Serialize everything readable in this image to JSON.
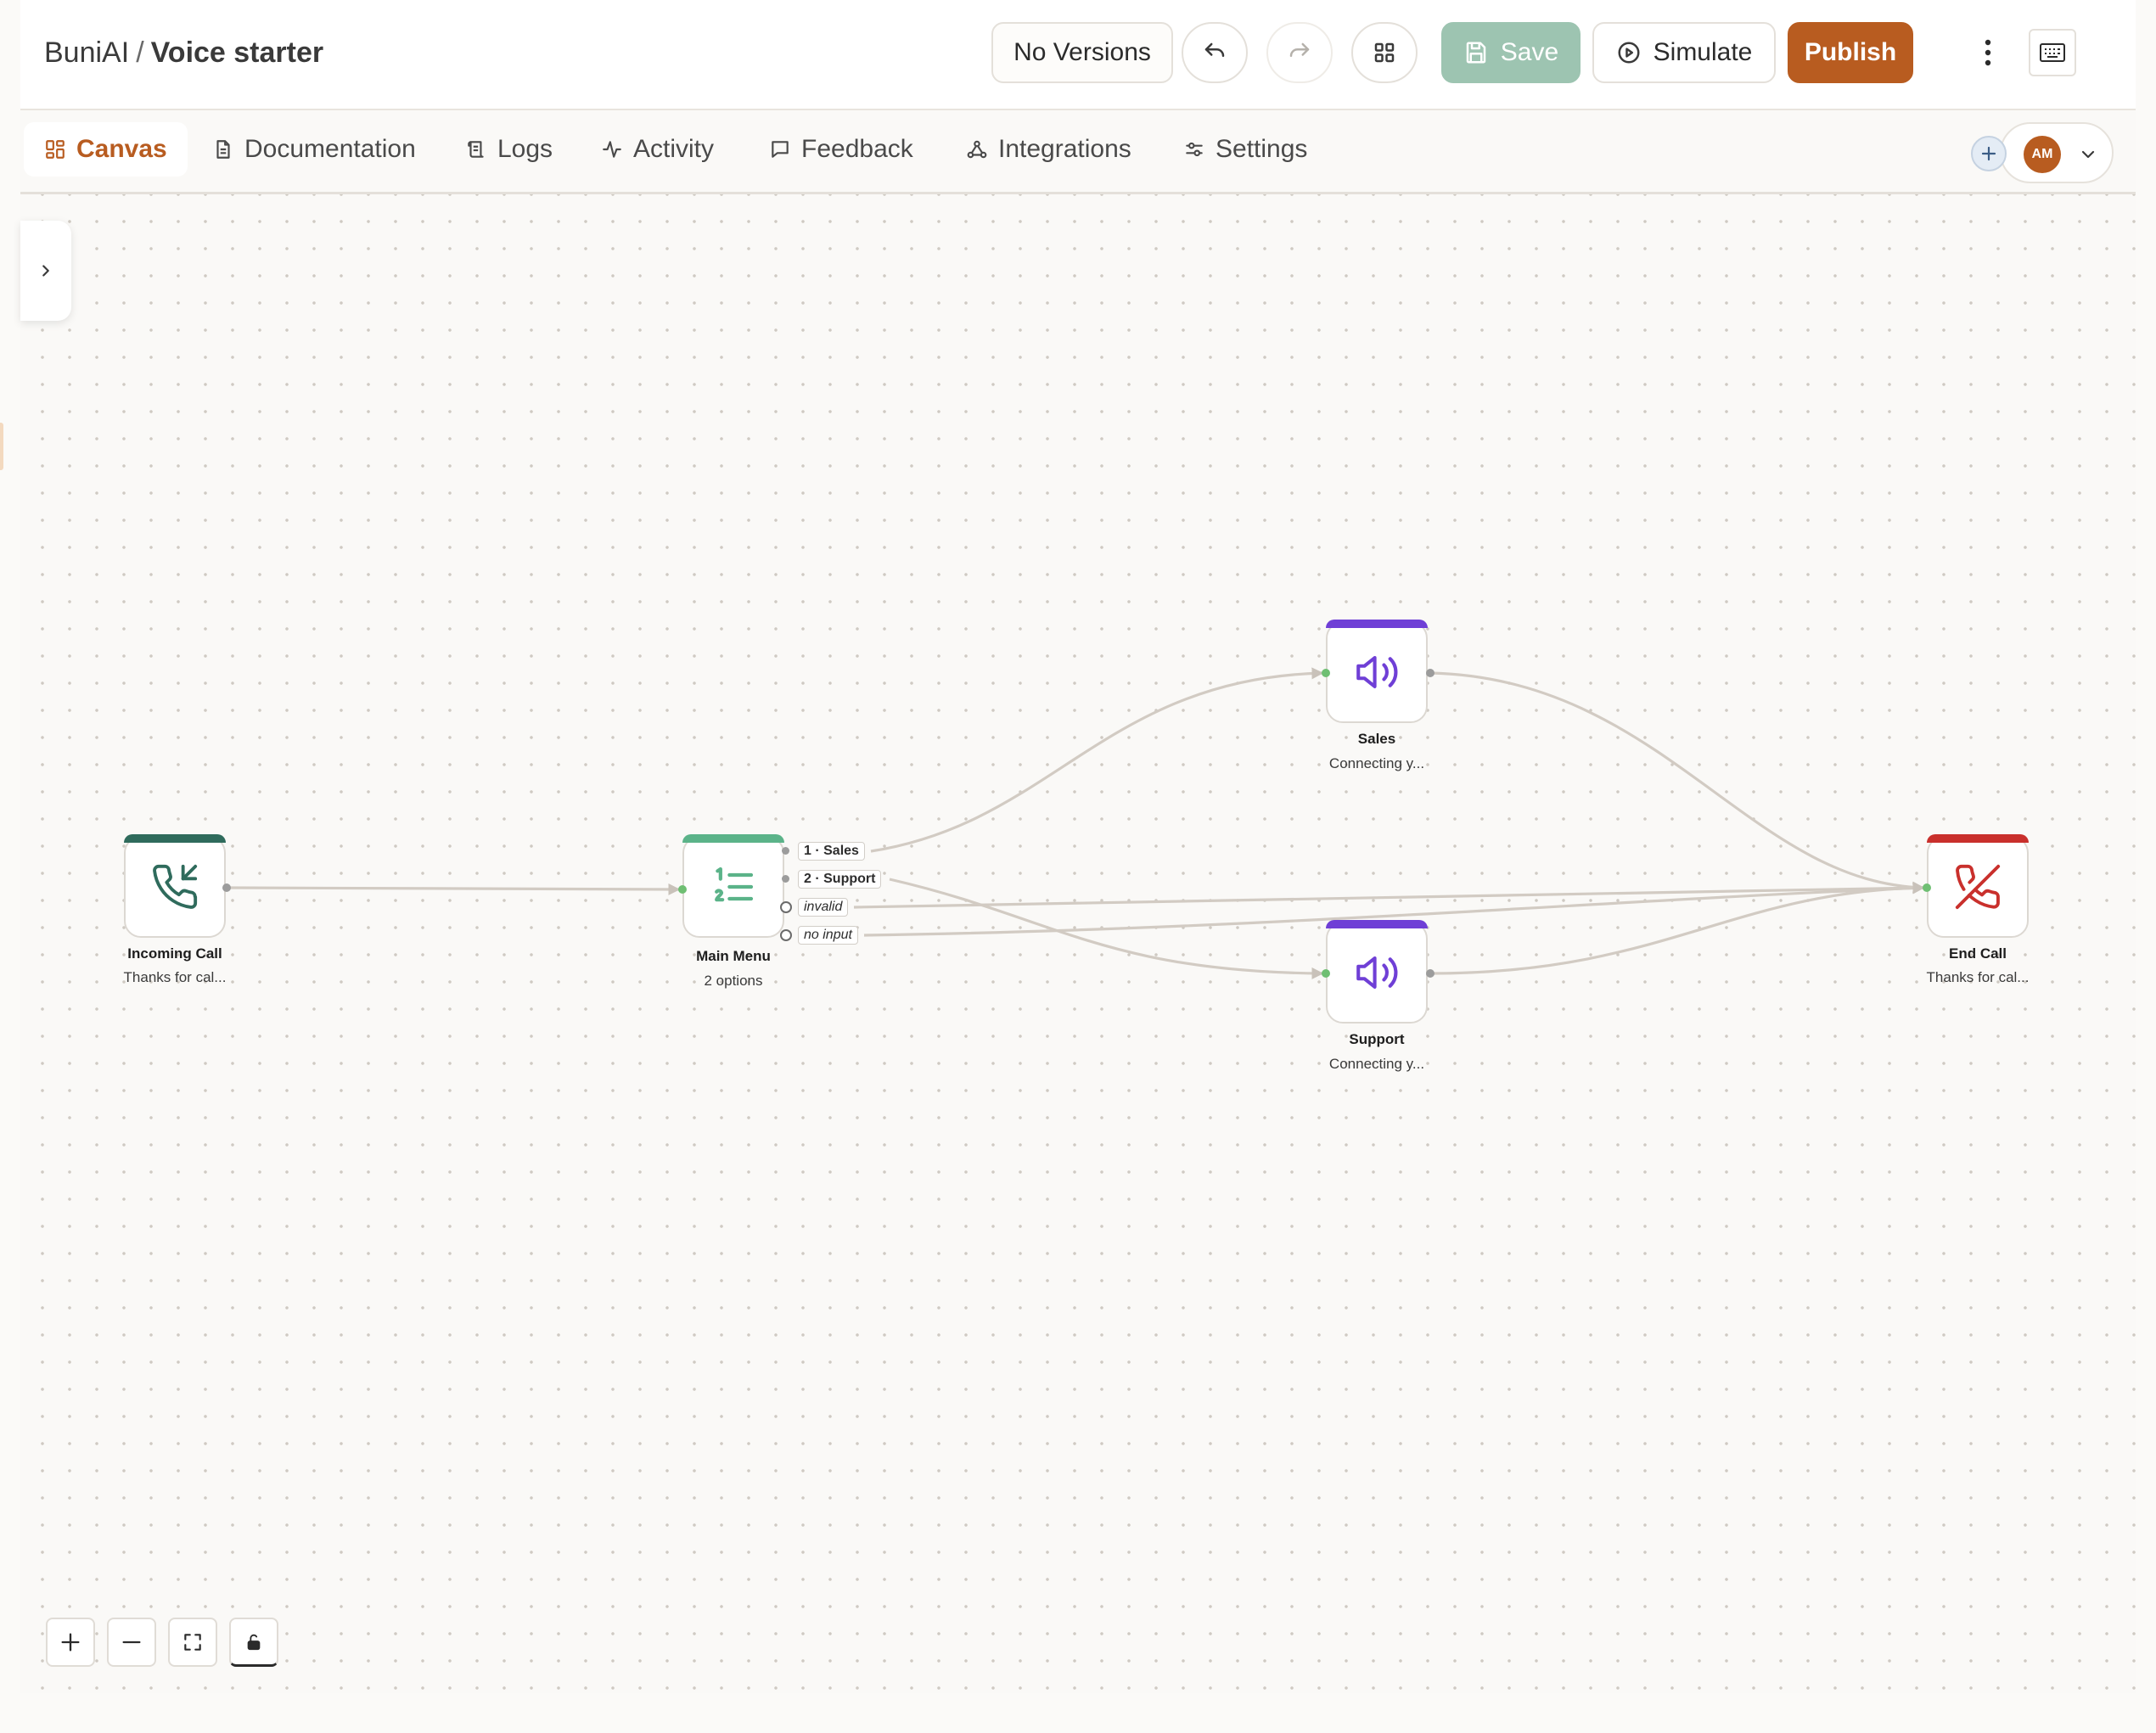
{
  "header": {
    "org": "BuniAI",
    "separator": "/",
    "project": "Voice starter",
    "versions_label": "No Versions",
    "save_label": "Save",
    "simulate_label": "Simulate",
    "publish_label": "Publish"
  },
  "tabs": [
    {
      "label": "Canvas",
      "icon": "canvas-grid-icon",
      "active": true
    },
    {
      "label": "Documentation",
      "icon": "document-icon"
    },
    {
      "label": "Logs",
      "icon": "logs-icon"
    },
    {
      "label": "Activity",
      "icon": "activity-icon"
    },
    {
      "label": "Feedback",
      "icon": "message-icon"
    },
    {
      "label": "Integrations",
      "icon": "integrations-icon"
    },
    {
      "label": "Settings",
      "icon": "settings-sliders-icon"
    }
  ],
  "user": {
    "initials": "AM"
  },
  "nodes": {
    "incoming": {
      "title": "Incoming Call",
      "subtitle": "Thanks for cal...",
      "accent": "#2f6b5c"
    },
    "menu": {
      "title": "Main Menu",
      "subtitle": "2 options",
      "accent": "#5bb389",
      "options": [
        "1 · Sales",
        "2 · Support",
        "invalid",
        "no input"
      ]
    },
    "sales": {
      "title": "Sales",
      "subtitle": "Connecting y...",
      "accent": "#6f3fd6"
    },
    "support": {
      "title": "Support",
      "subtitle": "Connecting y...",
      "accent": "#6f3fd6"
    },
    "end": {
      "title": "End Call",
      "subtitle": "Thanks for cal...",
      "accent": "#c9302c"
    }
  },
  "colors": {
    "brand": "#b85c20",
    "save": "#9dc4b1",
    "edge": "#d2cbc3"
  }
}
